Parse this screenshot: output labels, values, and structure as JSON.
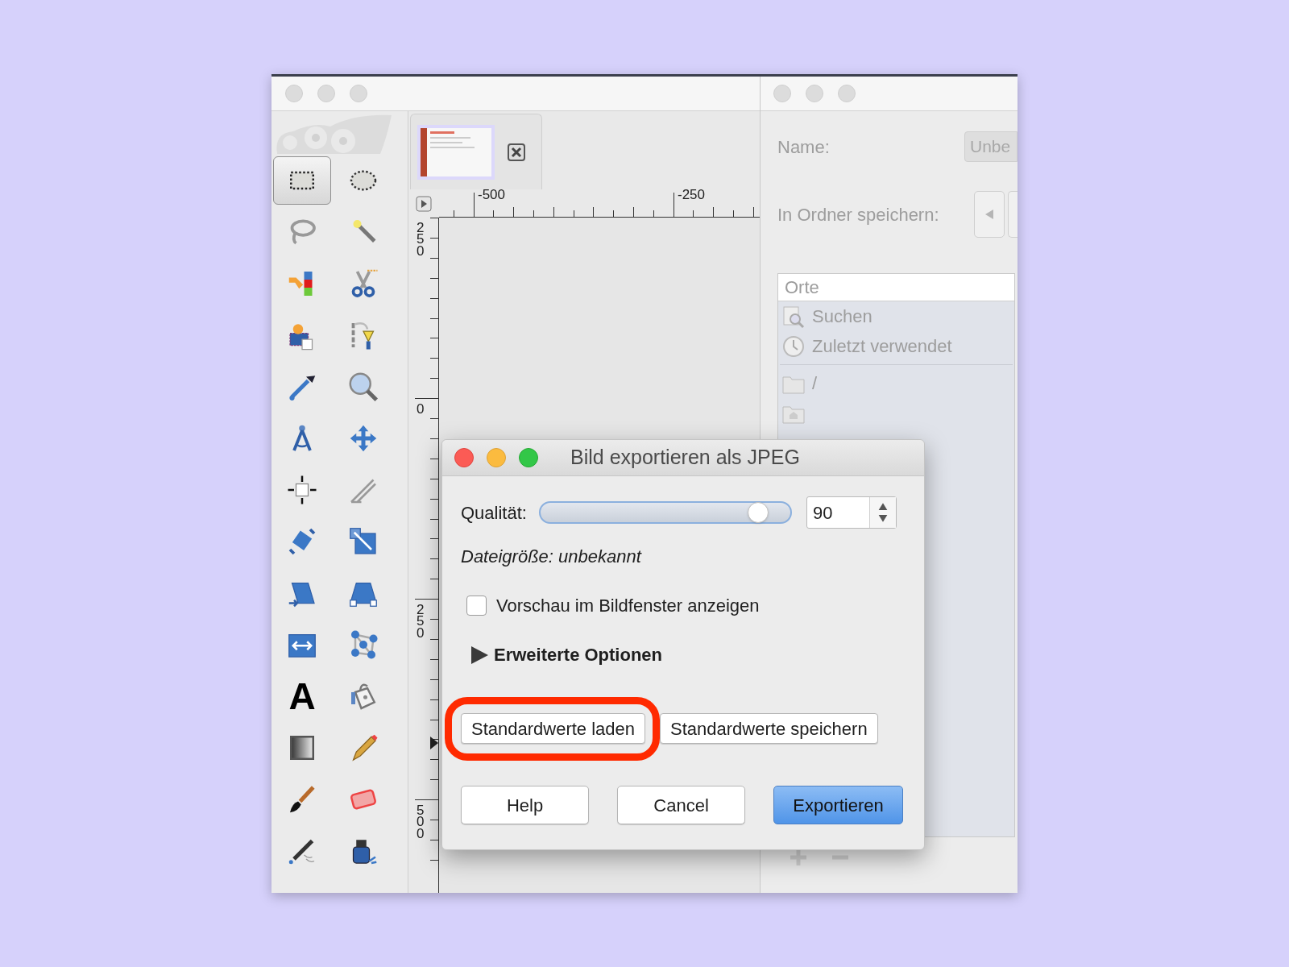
{
  "image_window": {
    "toolbox": {
      "tools": [
        {
          "kind": "rect-select",
          "selected": true
        },
        {
          "kind": "ellipse-select",
          "selected": false
        },
        {
          "kind": "lasso",
          "selected": false
        },
        {
          "kind": "wand",
          "selected": false
        },
        {
          "kind": "color-select",
          "selected": false
        },
        {
          "kind": "scissors",
          "selected": false
        },
        {
          "kind": "foreground-select",
          "selected": false
        },
        {
          "kind": "paths",
          "selected": false
        },
        {
          "kind": "eyedropper",
          "selected": false
        },
        {
          "kind": "zoom",
          "selected": false
        },
        {
          "kind": "measure",
          "selected": false
        },
        {
          "kind": "move",
          "selected": false
        },
        {
          "kind": "align",
          "selected": false
        },
        {
          "kind": "crop",
          "selected": false
        },
        {
          "kind": "rotate",
          "selected": false
        },
        {
          "kind": "scale",
          "selected": false
        },
        {
          "kind": "shear",
          "selected": false
        },
        {
          "kind": "perspective",
          "selected": false
        },
        {
          "kind": "flip",
          "selected": false
        },
        {
          "kind": "cage",
          "selected": false
        },
        {
          "kind": "text",
          "glyph": "A",
          "selected": false
        },
        {
          "kind": "bucket",
          "selected": false
        },
        {
          "kind": "gradient",
          "selected": false
        },
        {
          "kind": "pencil",
          "selected": false
        },
        {
          "kind": "brush",
          "selected": false
        },
        {
          "kind": "eraser",
          "selected": false
        },
        {
          "kind": "airbrush",
          "selected": false
        },
        {
          "kind": "ink",
          "selected": false
        }
      ]
    },
    "rulers": {
      "horizontal_labels": [
        "-500",
        "-250"
      ],
      "vertical_labels": [
        "250",
        "0",
        "250",
        "500"
      ]
    }
  },
  "export_window": {
    "name_label": "Name:",
    "name_value": "Unbe",
    "folder_label": "In Ordner speichern:",
    "places": {
      "header": "Orte",
      "items": [
        {
          "kind": "search",
          "label": "Suchen"
        },
        {
          "kind": "recent",
          "label": "Zuletzt verwendet"
        },
        {
          "kind": "separator"
        },
        {
          "kind": "folder",
          "label": "/"
        },
        {
          "kind": "home"
        }
      ]
    }
  },
  "dialog": {
    "title": "Bild exportieren als JPEG",
    "quality_label": "Qualität:",
    "quality": {
      "level": 0.87,
      "value": "90"
    },
    "file_size": "Dateigröße: unbekannt",
    "preview_checkbox": {
      "label": "Vorschau im Bildfenster anzeigen",
      "checked": false
    },
    "advanced": {
      "label": "Erweiterte Optionen",
      "expanded": false
    },
    "defaults_buttons": [
      {
        "label": "Standardwerte laden",
        "highlighted": true
      },
      {
        "label": "Standardwerte speichern",
        "highlighted": false
      }
    ],
    "buttons": [
      {
        "label": "Help",
        "default": false
      },
      {
        "label": "Cancel",
        "default": false
      },
      {
        "label": "Exportieren",
        "default": true
      }
    ]
  }
}
